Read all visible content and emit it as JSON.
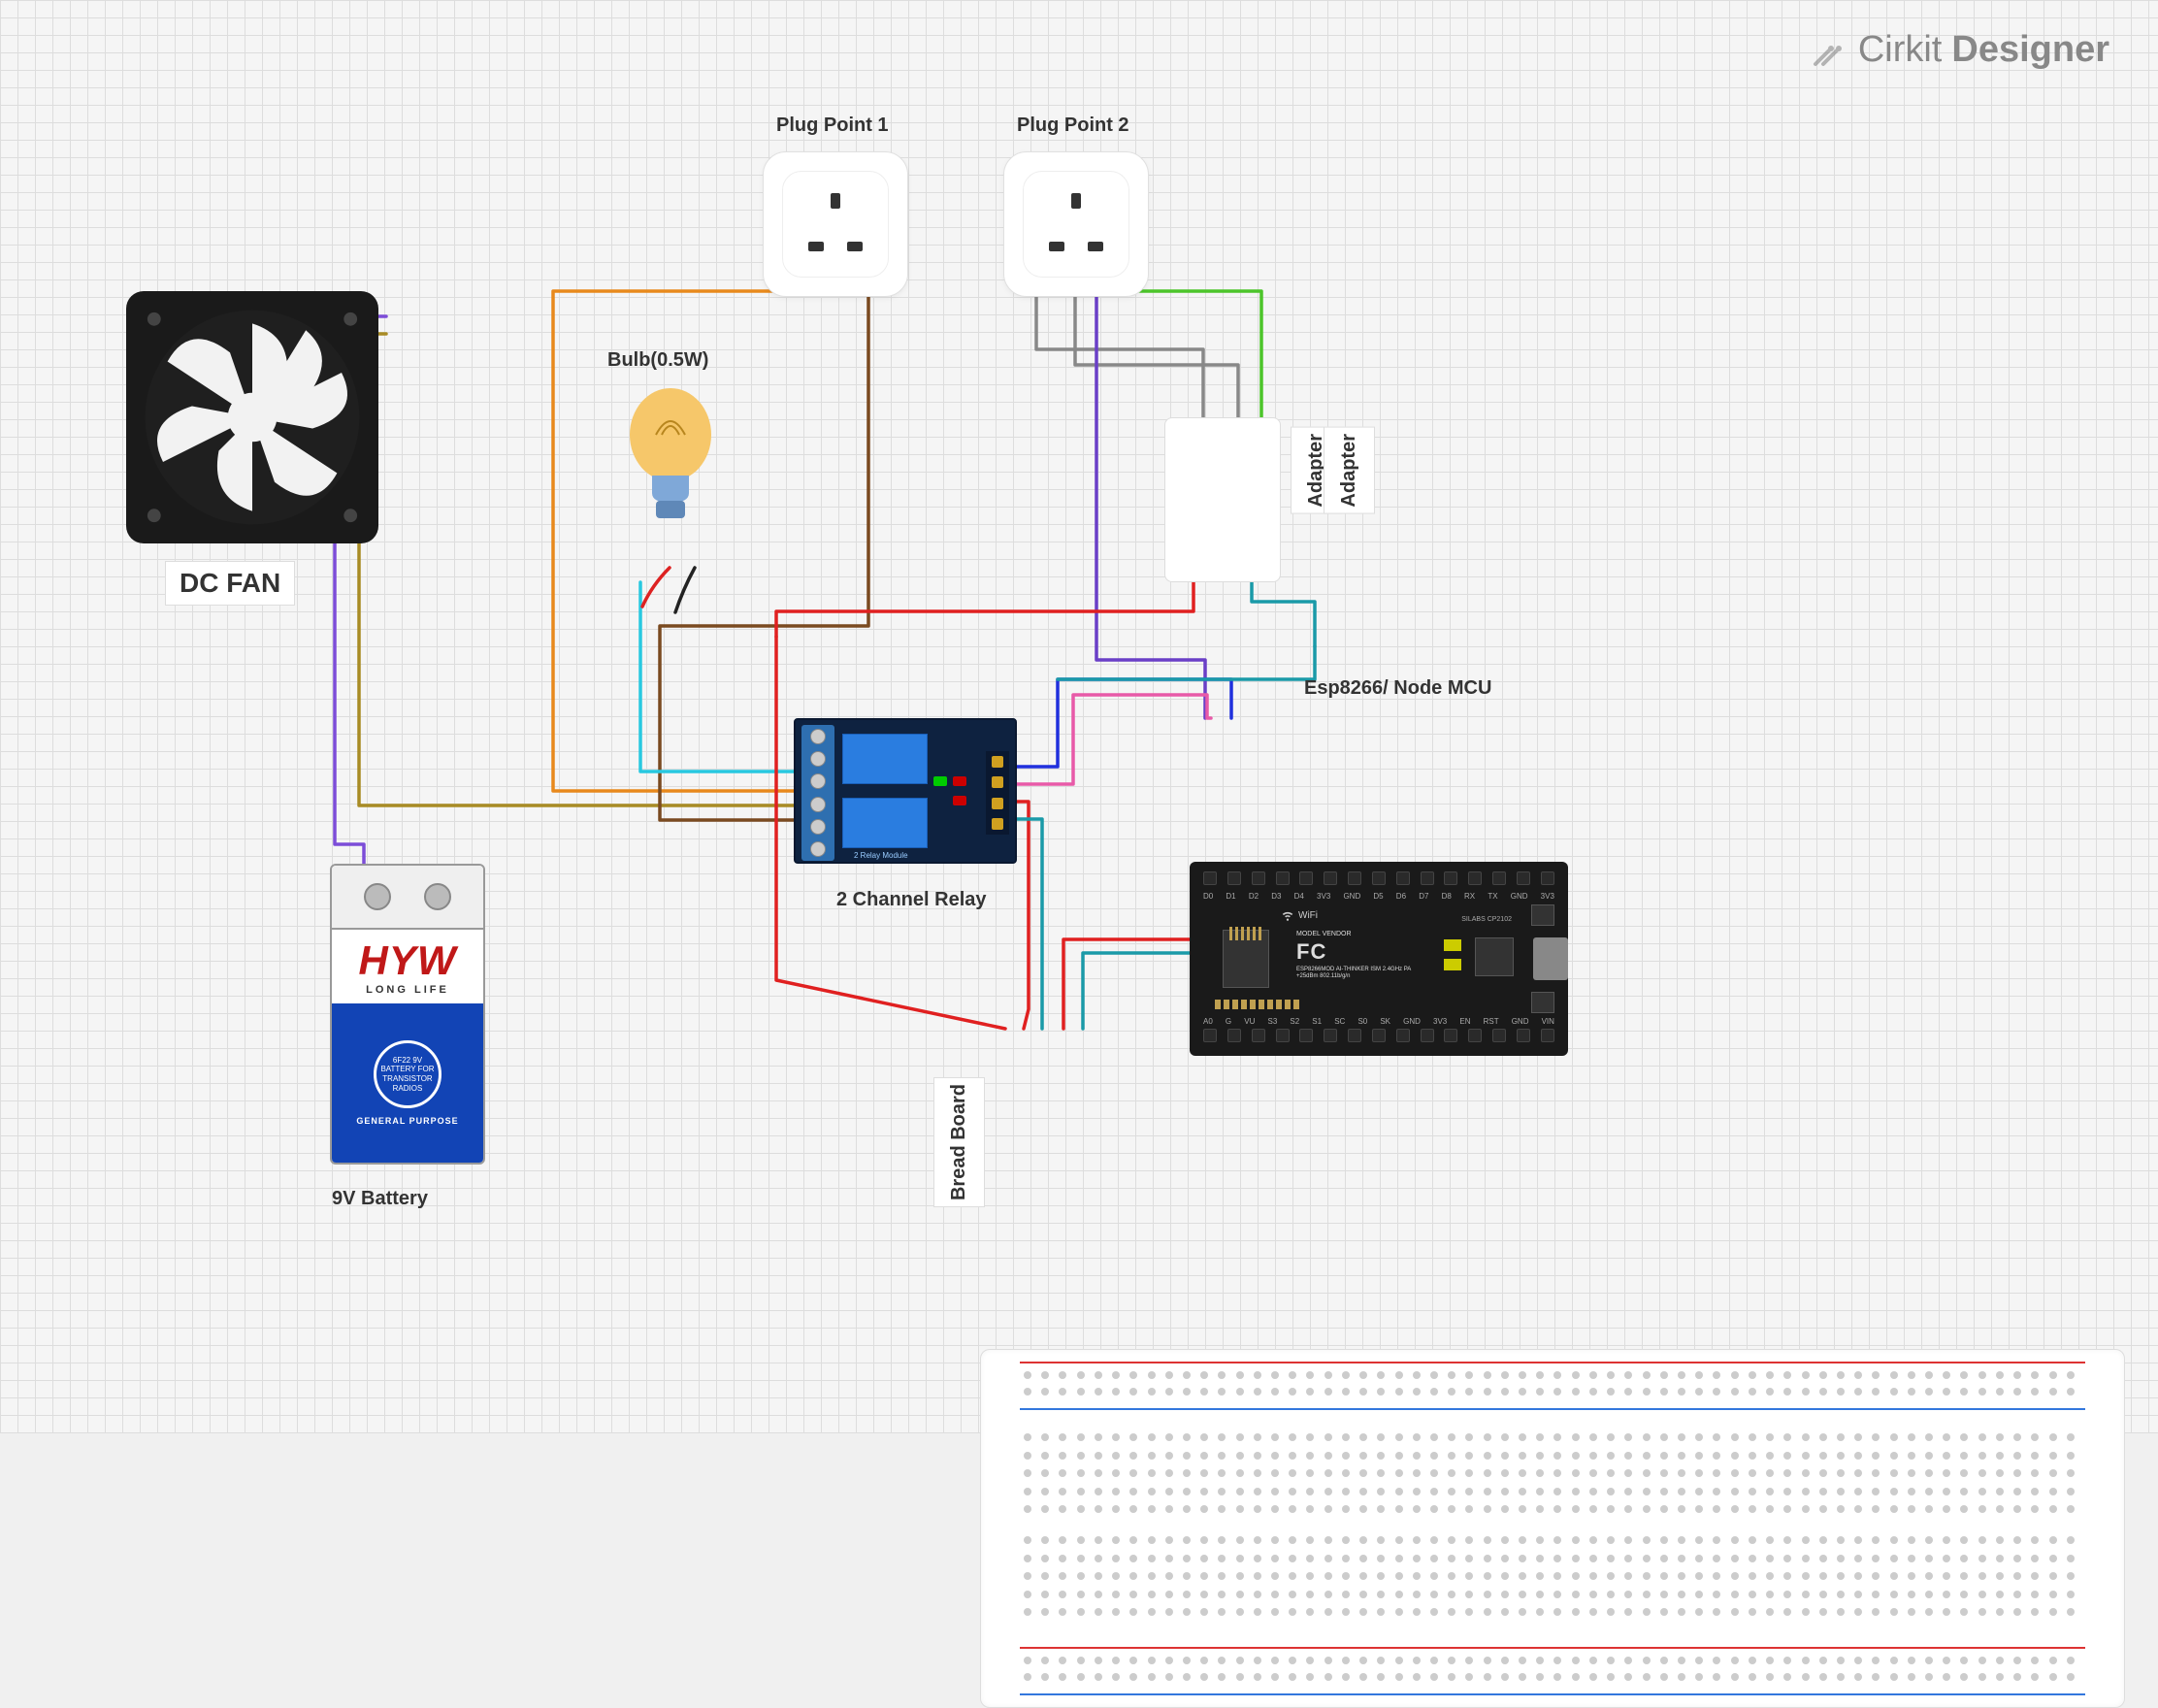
{
  "brand": {
    "name": "Cirkit",
    "suffix": "Designer"
  },
  "components": {
    "fan": {
      "label": "DC FAN"
    },
    "plug1": {
      "label": "Plug Point 1"
    },
    "plug2": {
      "label": "Plug Point 2"
    },
    "bulb": {
      "label": "Bulb(0.5W)"
    },
    "battery": {
      "label": "9V Battery",
      "brand": "HYW",
      "longlife": "LONG LIFE",
      "spec": "6F22 9V BATTERY FOR TRANSISTOR RADIOS",
      "gp": "GENERAL PURPOSE"
    },
    "relay": {
      "label": "2 Channel Relay",
      "board_text": "2 Relay Module"
    },
    "adapter": {
      "label": "Adapter",
      "label2": "Adapter"
    },
    "mcu": {
      "label": "Esp8266/ Node MCU",
      "pins_top": [
        "D0",
        "D1",
        "D2",
        "D3",
        "D4",
        "3V3",
        "GND",
        "D5",
        "D6",
        "D7",
        "D8",
        "RX",
        "TX",
        "GND",
        "3V3"
      ],
      "pins_bot": [
        "A0",
        "G",
        "VU",
        "S3",
        "S2",
        "S1",
        "SC",
        "S0",
        "SK",
        "GND",
        "3V3",
        "EN",
        "RST",
        "GND",
        "VIN"
      ],
      "chip_label": "WiFi",
      "vendor": "MODEL VENDOR",
      "esp_text": "ESP8266MOD AI-THINKER ISM 2.4GHz PA +25dBm 802.11b/g/n",
      "silabs": "SILABS CP2102",
      "fcc": "FC"
    },
    "breadboard": {
      "label": "Bread Board"
    }
  },
  "wires": [
    {
      "name": "battery-to-fan-purple",
      "color": "#7c4dd8"
    },
    {
      "name": "fan-to-relay-olive",
      "color": "#a88b25"
    },
    {
      "name": "plug1-to-relay-orange",
      "color": "#e8891c"
    },
    {
      "name": "plug1-to-relay-brown",
      "color": "#7a4a20"
    },
    {
      "name": "bulb-to-relay-cyan",
      "color": "#28c8e0"
    },
    {
      "name": "bulb-red",
      "color": "#dd2222"
    },
    {
      "name": "bulb-black",
      "color": "#222"
    },
    {
      "name": "plug2-to-adapter-gray1",
      "color": "#888"
    },
    {
      "name": "plug2-to-adapter-gray2",
      "color": "#888"
    },
    {
      "name": "plug2-to-relay-green",
      "color": "#4cc52a"
    },
    {
      "name": "plug2-to-mcu-purple",
      "color": "#6a3fc7"
    },
    {
      "name": "adapter-to-bboard-red",
      "color": "#e02020"
    },
    {
      "name": "adapter-to-bboard-teal",
      "color": "#1a9aa8"
    },
    {
      "name": "relay-to-mcu-blue",
      "color": "#2030dd"
    },
    {
      "name": "relay-to-mcu-pink",
      "color": "#e85aa8"
    },
    {
      "name": "relay-to-bboard-red",
      "color": "#e02020"
    },
    {
      "name": "relay-to-bboard-teal",
      "color": "#1a9aa8"
    },
    {
      "name": "mcu-to-bboard-red",
      "color": "#e02020"
    },
    {
      "name": "mcu-to-bboard-teal",
      "color": "#1a9aa8"
    }
  ]
}
